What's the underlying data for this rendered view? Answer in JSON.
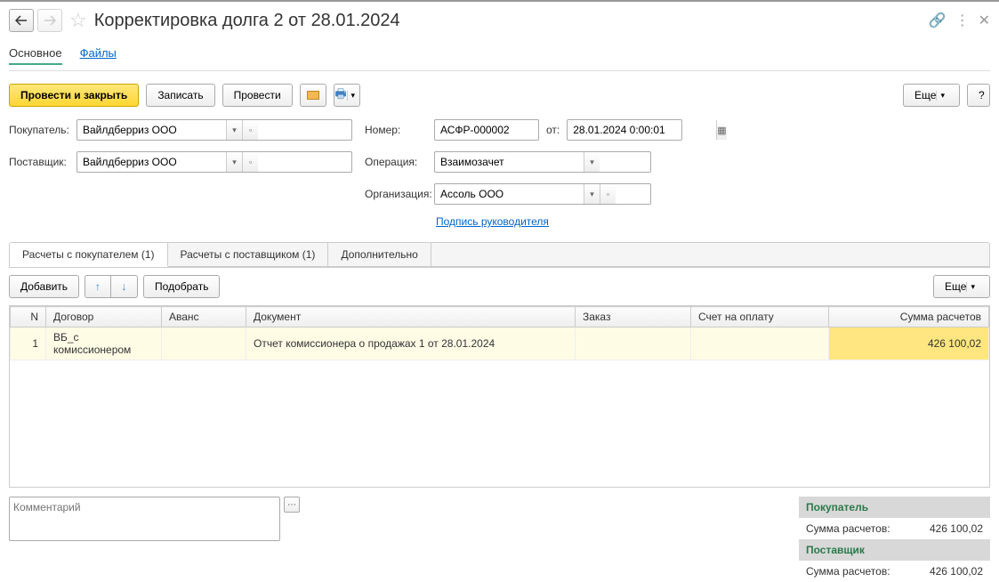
{
  "doc_title": "Корректировка долга 2 от 28.01.2024",
  "nav": {
    "main": "Основное",
    "files": "Файлы"
  },
  "toolbar": {
    "post_close": "Провести и закрыть",
    "save": "Записать",
    "post": "Провести",
    "more": "Еще"
  },
  "labels": {
    "buyer": "Покупатель:",
    "supplier": "Поставщик:",
    "number": "Номер:",
    "date_from": "от:",
    "operation": "Операция:",
    "organization": "Организация:",
    "sig_link": "Подпись руководителя"
  },
  "fields": {
    "buyer": "Вайлдберриз ООО",
    "supplier": "Вайлдберриз ООО",
    "number": "АСФР-000002",
    "date": "28.01.2024 0:00:01",
    "operation": "Взаимозачет",
    "organization": "Ассоль ООО"
  },
  "tabs": {
    "t1": "Расчеты с покупателем (1)",
    "t2": "Расчеты с поставщиком (1)",
    "t3": "Дополнительно"
  },
  "subbar": {
    "add": "Добавить",
    "pick": "Подобрать",
    "more": "Еще"
  },
  "grid": {
    "headers": {
      "n": "N",
      "contract": "Договор",
      "advance": "Аванс",
      "document": "Документ",
      "order": "Заказ",
      "invoice": "Счет на оплату",
      "amount": "Сумма расчетов"
    },
    "rows": [
      {
        "n": "1",
        "contract": "ВБ_с комиссионером",
        "advance": "",
        "document": "Отчет комиссионера о продажах 1 от 28.01.2024",
        "order": "",
        "invoice": "",
        "amount": "426 100,02"
      }
    ]
  },
  "comment_placeholder": "Комментарий",
  "totals": {
    "buyer_hdr": "Покупатель",
    "supplier_hdr": "Поставщик",
    "sum_label": "Сумма расчетов:",
    "buyer_sum": "426 100,02",
    "supplier_sum": "426 100,02"
  }
}
